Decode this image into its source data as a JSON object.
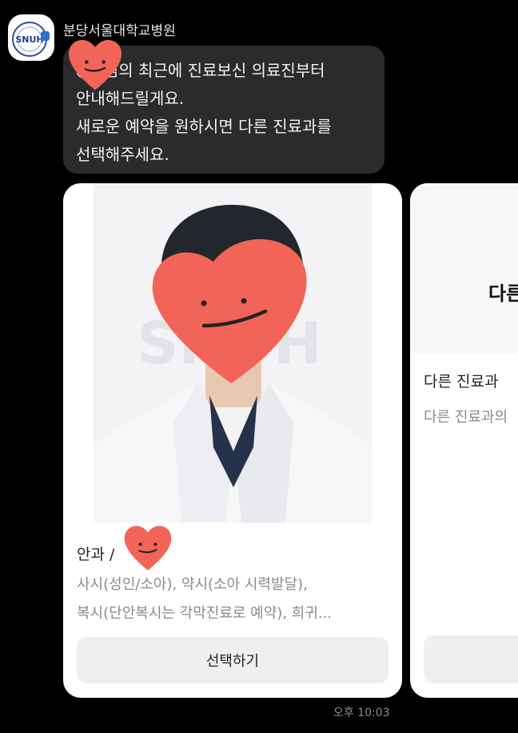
{
  "chat": {
    "sender": {
      "name": "분당서울대학교병원",
      "avatar_logo_text": "SNUH"
    },
    "message_lines": [
      "○○님의 최근에 진료보신 의료진부터",
      "안내해드릴게요.",
      "새로운 예약을 원하시면 다른 진료과를",
      "선택해주세요."
    ],
    "timestamp": "오후 10:03"
  },
  "cards": [
    {
      "photo_watermark": "SNUH",
      "department": "안과 /",
      "description_lines": [
        "사시(성인/소아), 약시(소아 시력발달),",
        "복시(단안복시는 각막진료로 예약), 희귀..."
      ],
      "button_label": "선택하기"
    },
    {
      "header_text": "다른",
      "title": "다른 진료과",
      "description": "다른 진료과의"
    }
  ],
  "colors": {
    "background": "#000000",
    "bubble": "#2b2b2d",
    "card": "#ffffff",
    "button": "#efefef",
    "heart": "#f26457"
  }
}
